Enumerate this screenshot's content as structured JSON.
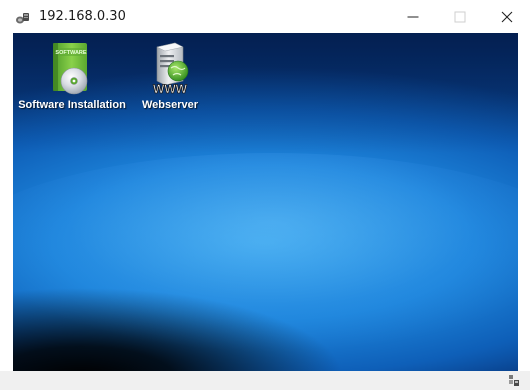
{
  "window": {
    "title": "192.168.0.30",
    "app_icon": "remote-desktop-icon",
    "controls": {
      "minimize_icon": "minimize-icon",
      "maximize_icon": "maximize-icon",
      "close_icon": "close-icon"
    }
  },
  "desktop": {
    "icons": [
      {
        "label": "Software Installation",
        "icon": "software-cd-icon",
        "badge": "SOFTWARE"
      },
      {
        "label": "Webserver",
        "icon": "webserver-icon",
        "badge": "WWW"
      }
    ]
  },
  "colors": {
    "desktop_top": "#052d6a",
    "desktop_mid": "#1e86dc",
    "desktop_highlight": "#3aa6ec",
    "titlebar": "#ffffff",
    "statusbar": "#f0f0f0"
  }
}
